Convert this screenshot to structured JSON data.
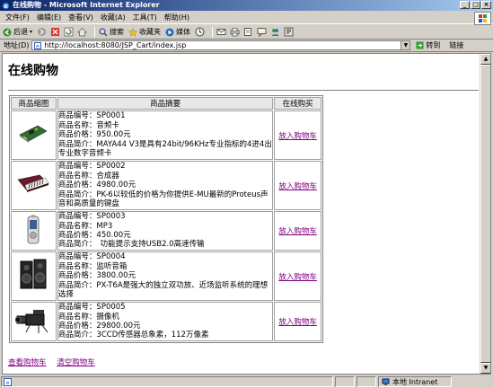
{
  "window": {
    "title": "在线购物 - Microsoft Internet Explorer",
    "controls": {
      "minimize": "_",
      "maximize": "□",
      "close": "×"
    }
  },
  "menu": [
    "文件(F)",
    "编辑(E)",
    "查看(V)",
    "收藏(A)",
    "工具(T)",
    "帮助(H)"
  ],
  "toolbar": {
    "back": "后退",
    "search": "搜索",
    "favorites": "收藏夹",
    "media": "媒体"
  },
  "address": {
    "label": "地址(D)",
    "url": "http://localhost:8080/JSP_Cart/index.jsp",
    "go": "转到",
    "links": "链接"
  },
  "page": {
    "heading": "在线购物",
    "columns": [
      "商品缩图",
      "商品摘要",
      "在线购买"
    ],
    "products": [
      {
        "code": "商品编号：SP0001",
        "name": "商品名称：音频卡",
        "price": "商品价格：950.00元",
        "intro": "商品简介：MAYA44 V3是具有24bit/96KHz专业指标的4进4出专业数字音频卡",
        "buy": "放入购物车",
        "thumb_icon": "sound-card-icon"
      },
      {
        "code": "商品编号：SP0002",
        "name": "商品名称：合成器",
        "price": "商品价格：4980.00元",
        "intro": "商品简介：PK-6以较低的价格为你提供E-MU最新的Proteus声音和高质量的键盘",
        "buy": "放入购物车",
        "thumb_icon": "synthesizer-icon"
      },
      {
        "code": "商品编号：SP0003",
        "name": "商品名称：MP3",
        "price": "商品价格：450.00元",
        "intro": "商品简介：　功能提示支持USB2.0高速传输",
        "buy": "放入购物车",
        "thumb_icon": "mp3-player-icon"
      },
      {
        "code": "商品编号：SP0004",
        "name": "商品名称：监听音箱",
        "price": "商品价格：3800.00元",
        "intro": "商品简介：PX-T6A是强大的独立双功放、近场监听系统的理想选择",
        "buy": "放入购物车",
        "thumb_icon": "speakers-icon"
      },
      {
        "code": "商品编号：SP0005",
        "name": "商品名称：摄像机",
        "price": "商品价格：29800.00元",
        "intro": "商品简介：3CCD传感器总象素，112万像素",
        "buy": "放入购物车",
        "thumb_icon": "camcorder-icon"
      }
    ],
    "view_cart": "查看购物车",
    "clear_cart": "清空购物车"
  },
  "status": {
    "zone": "本地 Intranet"
  }
}
